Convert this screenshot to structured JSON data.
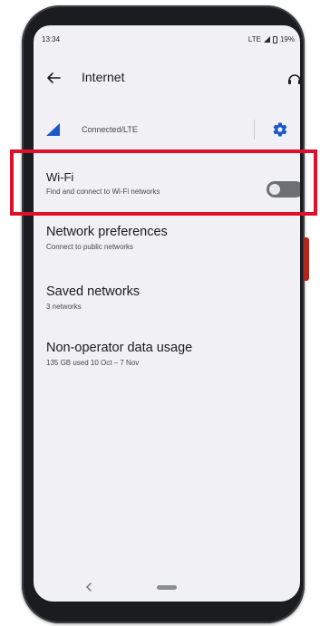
{
  "status_bar": {
    "time": "13:34",
    "network": "LTE",
    "battery": "19%"
  },
  "app_bar": {
    "title": "Internet"
  },
  "connection": {
    "label": "Connected/LTE"
  },
  "settings": {
    "wifi": {
      "title": "Wi-Fi",
      "subtitle": "Find and connect to Wi-Fi networks",
      "enabled": false
    },
    "network_preferences": {
      "title": "Network preferences",
      "subtitle": "Connect to public networks"
    },
    "saved_networks": {
      "title": "Saved networks",
      "subtitle": "3 networks"
    },
    "data_usage": {
      "title": "Non-operator data usage",
      "subtitle": "135 GB used 10 Oct – 7 Nov"
    }
  },
  "colors": {
    "accent": "#1a57c8",
    "highlight": "#e0102a",
    "toggle_off": "#6e6f74",
    "screen_bg": "#f1f0f5"
  },
  "icons": {
    "back": "arrow-back-icon",
    "help": "help-icon",
    "signal": "signal-icon",
    "settings": "gear-icon",
    "nav_back": "chevron-left-icon"
  }
}
